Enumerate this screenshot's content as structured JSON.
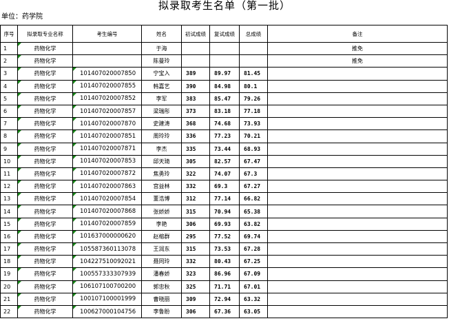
{
  "title": "拟录取考生名单（第一批）",
  "unit_label": "单位：药学院",
  "columns": [
    "序号",
    "拟录取专业名称",
    "考生编号",
    "姓名",
    "初试成绩",
    "复试成绩",
    "总成绩",
    "备注"
  ],
  "rows": [
    {
      "no": "1",
      "major": "药物化学",
      "id": "",
      "name": "于海",
      "init": "",
      "re": "",
      "total": "",
      "note": "推免"
    },
    {
      "no": "2",
      "major": "药物化学",
      "id": "",
      "name": "陈曼玲",
      "init": "",
      "re": "",
      "total": "",
      "note": "推免"
    },
    {
      "no": "3",
      "major": "药物化学",
      "id": "101407020007850",
      "name": "宁宝入",
      "init": "389",
      "re": "89.97",
      "total": "81.45",
      "note": ""
    },
    {
      "no": "4",
      "major": "药物化学",
      "id": "101407020007855",
      "name": "韩嘉艺",
      "init": "390",
      "re": "84.98",
      "total": "80.1",
      "note": ""
    },
    {
      "no": "5",
      "major": "药物化学",
      "id": "101407020007852",
      "name": "李军",
      "init": "383",
      "re": "85.47",
      "total": "79.26",
      "note": ""
    },
    {
      "no": "6",
      "major": "药物化学",
      "id": "101407020007857",
      "name": "梁瑞彤",
      "init": "373",
      "re": "83.18",
      "total": "77.18",
      "note": ""
    },
    {
      "no": "7",
      "major": "药物化学",
      "id": "101407020007870",
      "name": "史建涛",
      "init": "368",
      "re": "74.68",
      "total": "73.93",
      "note": ""
    },
    {
      "no": "8",
      "major": "药物化学",
      "id": "101407020007851",
      "name": "周玲玲",
      "init": "336",
      "re": "77.23",
      "total": "70.21",
      "note": ""
    },
    {
      "no": "9",
      "major": "药物化学",
      "id": "101407020007871",
      "name": "李杰",
      "init": "335",
      "re": "73.44",
      "total": "68.93",
      "note": ""
    },
    {
      "no": "10",
      "major": "药物化学",
      "id": "101407020007853",
      "name": "邱天琦",
      "init": "305",
      "re": "82.57",
      "total": "67.47",
      "note": ""
    },
    {
      "no": "11",
      "major": "药物化学",
      "id": "101407020007872",
      "name": "焦勇玲",
      "init": "322",
      "re": "74.07",
      "total": "67.3",
      "note": ""
    },
    {
      "no": "12",
      "major": "药物化学",
      "id": "101407020007863",
      "name": "宫益林",
      "init": "332",
      "re": "69.3",
      "total": "67.27",
      "note": ""
    },
    {
      "no": "13",
      "major": "药物化学",
      "id": "101407020007854",
      "name": "董浩博",
      "init": "312",
      "re": "77.14",
      "total": "66.82",
      "note": ""
    },
    {
      "no": "14",
      "major": "药物化学",
      "id": "101407020007868",
      "name": "张娇娇",
      "init": "315",
      "re": "70.94",
      "total": "65.38",
      "note": ""
    },
    {
      "no": "15",
      "major": "药物化学",
      "id": "101407020007859",
      "name": "李艳",
      "init": "306",
      "re": "69.93",
      "total": "63.82",
      "note": ""
    },
    {
      "no": "16",
      "major": "药物化学",
      "id": "101637000000620",
      "name": "赵榕群",
      "init": "295",
      "re": "77.52",
      "total": "69.74",
      "note": ""
    },
    {
      "no": "17",
      "major": "药物化学",
      "id": "105587360113078",
      "name": "王润东",
      "init": "315",
      "re": "73.53",
      "total": "67.28",
      "note": ""
    },
    {
      "no": "18",
      "major": "药物化学",
      "id": "104227510092021",
      "name": "聂同玲",
      "init": "332",
      "re": "80.43",
      "total": "67.25",
      "note": ""
    },
    {
      "no": "19",
      "major": "药物化学",
      "id": "100557333307939",
      "name": "潘春娇",
      "init": "323",
      "re": "86.96",
      "total": "67.09",
      "note": ""
    },
    {
      "no": "20",
      "major": "药物化学",
      "id": "106107100700200",
      "name": "郭忠秋",
      "init": "325",
      "re": "71.71",
      "total": "67.01",
      "note": ""
    },
    {
      "no": "21",
      "major": "药物化学",
      "id": "100107100001999",
      "name": "曹晓丽",
      "init": "309",
      "re": "72.94",
      "total": "63.32",
      "note": ""
    },
    {
      "no": "22",
      "major": "药物化学",
      "id": "100627000104756",
      "name": "李鲁盼",
      "init": "306",
      "re": "67.36",
      "total": "63.05",
      "note": ""
    }
  ]
}
